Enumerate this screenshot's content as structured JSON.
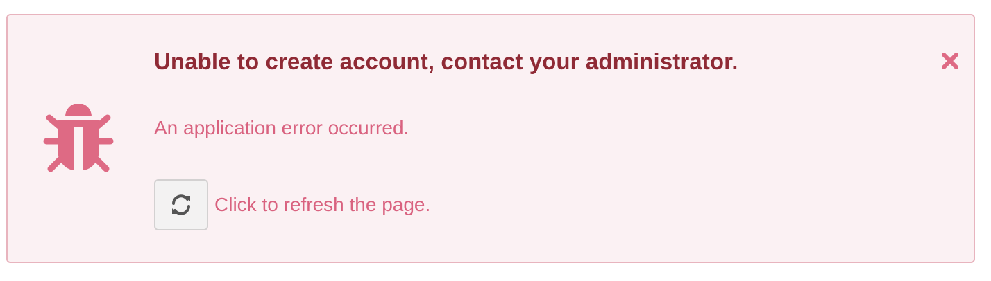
{
  "alert": {
    "title": "Unable to create account, contact your administrator.",
    "message": "An application error occurred.",
    "refresh_label": "Click to refresh the page.",
    "icons": {
      "status": "bug-icon",
      "refresh": "refresh-icon",
      "close": "close-icon"
    },
    "colors": {
      "background": "#fbf1f3",
      "border": "#e8b4be",
      "title": "#8f2a35",
      "text": "#d9627f",
      "icon": "#de6a84"
    }
  }
}
